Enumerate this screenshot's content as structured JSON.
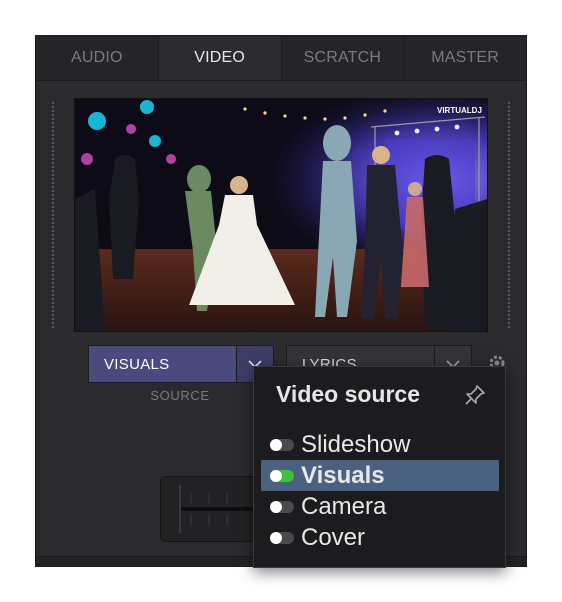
{
  "tabs": [
    {
      "label": "AUDIO",
      "active": false
    },
    {
      "label": "VIDEO",
      "active": true
    },
    {
      "label": "SCRATCH",
      "active": false
    },
    {
      "label": "MASTER",
      "active": false
    }
  ],
  "preview": {
    "watermark": "VIRTUALDJ"
  },
  "source_select": {
    "value": "VISUALS",
    "caption": "SOURCE"
  },
  "lyrics_select": {
    "value": "LYRICS"
  },
  "popup": {
    "title": "Video source",
    "options": [
      {
        "label": "Slideshow",
        "selected": false
      },
      {
        "label": "Visuals",
        "selected": true
      },
      {
        "label": "Camera",
        "selected": false
      },
      {
        "label": "Cover",
        "selected": false
      }
    ]
  },
  "colors": {
    "panel_bg": "#2b2b2e",
    "source_accent": "#4a4a7e",
    "highlight": "#4c607f",
    "toggle_on": "#3cc23c"
  }
}
